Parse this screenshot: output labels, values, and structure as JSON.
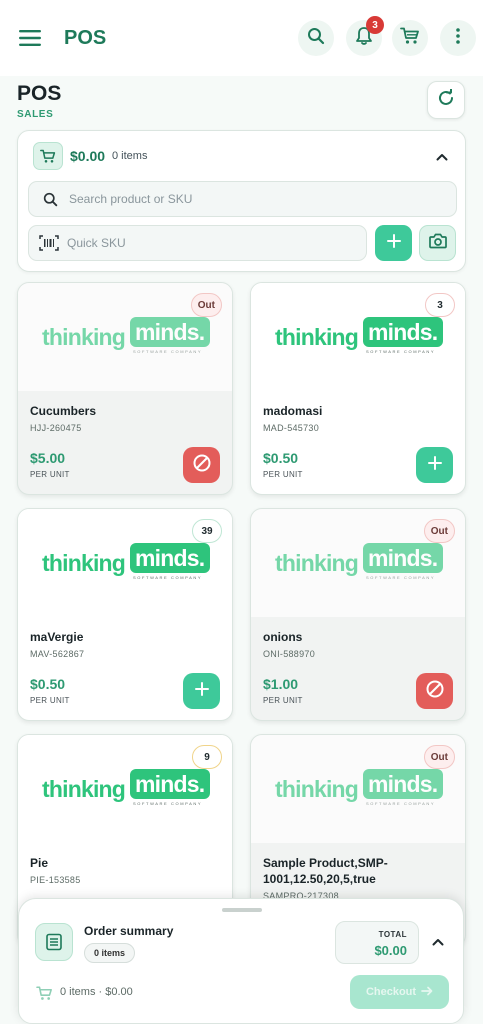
{
  "app_bar": {
    "title": "POS",
    "notification_count": "3",
    "icons": [
      "menu-icon",
      "search-icon",
      "bell-icon",
      "cart-icon",
      "more-vertical-icon"
    ]
  },
  "page": {
    "title": "POS",
    "subtitle": "SALES"
  },
  "cart": {
    "amount": "$0.00",
    "items": "0 items",
    "search_placeholder": "Search product or SKU",
    "sku_placeholder": "Quick SKU"
  },
  "products": [
    {
      "name": "Cucumbers",
      "sku": "HJJ-260475",
      "price": "$5.00",
      "unit": "PER UNIT",
      "stock": "Out",
      "available": false
    },
    {
      "name": "madomasi",
      "sku": "MAD-545730",
      "price": "$0.50",
      "unit": "PER UNIT",
      "stock": "3",
      "available": true
    },
    {
      "name": "maVergie",
      "sku": "MAV-562867",
      "price": "$0.50",
      "unit": "PER UNIT",
      "stock": "39",
      "available": true
    },
    {
      "name": "onions",
      "sku": "ONI-588970",
      "price": "$1.00",
      "unit": "PER UNIT",
      "stock": "Out",
      "available": false
    },
    {
      "name": "Pie",
      "sku": "PIE-153585",
      "price": "",
      "unit": "",
      "stock": "9",
      "available": true
    },
    {
      "name": "Sample Product,SMP-1001,12.50,20,5,true",
      "sku": "SAMPRO-217308",
      "price": "",
      "unit": "",
      "stock": "Out",
      "available": false
    }
  ],
  "logo": {
    "part1": "thinking",
    "part2": "minds.",
    "tagline": "SOFTWARE COMPANY"
  },
  "order_summary": {
    "title": "Order summary",
    "items_pill": "0 items",
    "total_label": "TOTAL",
    "total_value": "$0.00",
    "footer_text": "0 items · $0.00",
    "checkout_label": "Checkout"
  },
  "colors": {
    "primary": "#3ec99a",
    "brand_text": "#1e7a5a",
    "danger": "#e35d5a",
    "notification": "#d83a36"
  }
}
